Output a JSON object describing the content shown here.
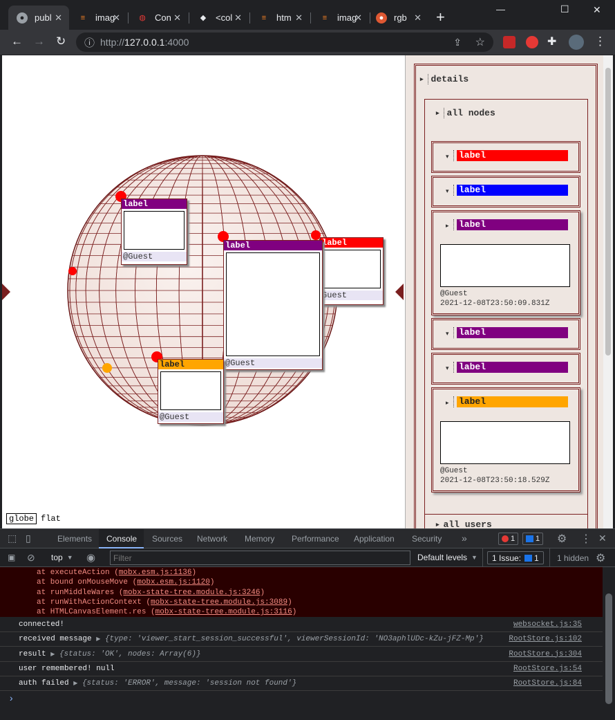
{
  "tabs": [
    {
      "title": "publ",
      "icon": "globe-icon",
      "active": true
    },
    {
      "title": "imag",
      "icon": "stackoverflow-icon"
    },
    {
      "title": "Con",
      "icon": "palette-icon"
    },
    {
      "title": "<col",
      "icon": "bird-icon"
    },
    {
      "title": "htm",
      "icon": "stackoverflow-icon"
    },
    {
      "title": "imag",
      "icon": "stackoverflow-icon"
    },
    {
      "title": "rgb",
      "icon": "duckduckgo-icon"
    }
  ],
  "new_tab": "+",
  "window_controls": {
    "minimize": "—",
    "maximize": "☐",
    "close": "✕"
  },
  "toolbar": {
    "back": "←",
    "forward": "→",
    "reload": "↻",
    "info": "ⓘ",
    "url_prefix": "http://",
    "url_host": "127.0.0.1",
    "url_port": ":4000",
    "share": "⇪",
    "star": "☆",
    "menu": "⋮"
  },
  "canvas": {
    "mode_globe": "globe",
    "mode_flat": "flat",
    "cards": [
      {
        "label": "label",
        "footer": "@Guest",
        "color": "#800080"
      },
      {
        "label": "label",
        "footer": "@Guest",
        "color": "#800080"
      },
      {
        "label": "label",
        "footer": "Guest",
        "color": "#ff0000"
      },
      {
        "label": "label",
        "footer": "@Guest",
        "color": "#ffa500"
      }
    ]
  },
  "panel": {
    "details": "details",
    "all_nodes": "all nodes",
    "all_users": "all users",
    "nodes": [
      {
        "label": "label",
        "color": "#ff0000",
        "expanded": false
      },
      {
        "label": "label",
        "color": "#0000ff",
        "expanded": false
      },
      {
        "label": "label",
        "color": "#800080",
        "expanded": true,
        "user": "@Guest",
        "timestamp": "2021-12-08T23:50:09.831Z"
      },
      {
        "label": "label",
        "color": "#800080",
        "expanded": false
      },
      {
        "label": "label",
        "color": "#800080",
        "expanded": false
      },
      {
        "label": "label",
        "color": "#ffa500",
        "expanded": true,
        "user": "@Guest",
        "timestamp": "2021-12-08T23:50:18.529Z"
      }
    ]
  },
  "devtools": {
    "tabs": [
      "Elements",
      "Console",
      "Sources",
      "Network",
      "Memory",
      "Performance",
      "Application",
      "Security"
    ],
    "active_tab": "Console",
    "more": "»",
    "error_count": "1",
    "issue_count": "1",
    "context": "top",
    "filter_placeholder": "Filter",
    "levels": "Default levels",
    "issues": "1 Issue:",
    "issues_n": "1",
    "hidden": "1 hidden",
    "stack": [
      {
        "text": "at executeAction (",
        "link": "mobx.esm.js:1136",
        "end": ")"
      },
      {
        "text": "at bound onMouseMove (",
        "link": "mobx.esm.js:1120",
        "end": ")"
      },
      {
        "text": "at runMiddleWares (",
        "link": "mobx-state-tree.module.js:3246",
        "end": ")"
      },
      {
        "text": "at runWithActionContext (",
        "link": "mobx-state-tree.module.js:3089",
        "end": ")"
      },
      {
        "text": "at HTMLCanvasElement.res (",
        "link": "mobx-state-tree.module.js:3116",
        "end": ")"
      }
    ],
    "logs": [
      {
        "msg": "connected!",
        "obj": "",
        "src": "websocket.js:35"
      },
      {
        "msg": "received message ",
        "obj": "{type: 'viewer_start_session_successful', viewerSessionId: 'NO3aphlUDc-kZu-jFZ-Mp'}",
        "src": "RootStore.js:102"
      },
      {
        "msg": "result ",
        "obj": "{status: 'OK', nodes: Array(6)}",
        "src": "RootStore.js:304"
      },
      {
        "msg": "user remembered! null",
        "obj": "",
        "src": "RootStore.js:54"
      },
      {
        "msg": "auth failed ",
        "obj": "{status: 'ERROR', message: 'session not found'}",
        "src": "RootStore.js:84"
      }
    ],
    "prompt": "›"
  }
}
